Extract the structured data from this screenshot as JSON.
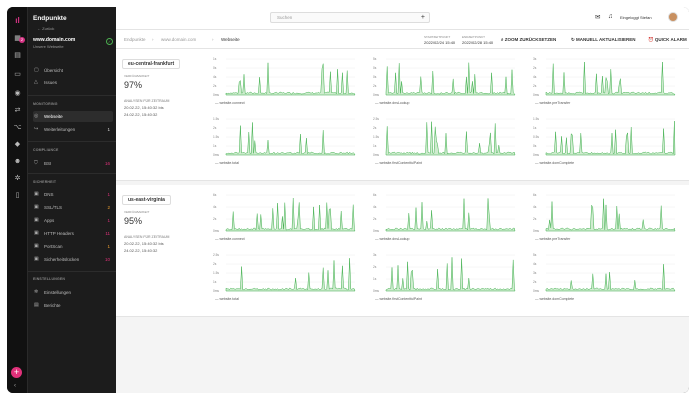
{
  "sidebar": {
    "title": "Endpunkte",
    "back": "Zurück",
    "domain": "www.domain.com",
    "domain_sub": "Unsere Webseite",
    "status_icon": "check-icon",
    "items_top": [
      {
        "label": "Übersicht",
        "icon": "dashboard-icon"
      },
      {
        "label": "Issues",
        "icon": "alert-icon"
      }
    ],
    "sections": {
      "monitoring": "MONITORING",
      "compliance": "COMPLIANCE",
      "security": "SICHERHEIT",
      "settings": "EINSTELLUNGEN"
    },
    "monitoring_items": [
      {
        "label": "Webseite",
        "icon": "globe-icon",
        "count": ""
      },
      {
        "label": "Weiterleitungen",
        "icon": "redirect-icon",
        "count": "1"
      }
    ],
    "compliance_items": [
      {
        "label": "BSI",
        "icon": "shield-icon",
        "count": "16"
      }
    ],
    "security_items": [
      {
        "label": "DNS",
        "icon": "dns-icon",
        "count": "1"
      },
      {
        "label": "SSL/TLS",
        "icon": "lock-icon",
        "count": "2"
      },
      {
        "label": "Apps",
        "icon": "apps-icon",
        "count": "1"
      },
      {
        "label": "HTTP Headers",
        "icon": "headers-icon",
        "count": "11"
      },
      {
        "label": "PortScan",
        "icon": "scan-icon",
        "count": "1"
      },
      {
        "label": "Sicherheitslücken",
        "icon": "bug-icon",
        "count": "10"
      }
    ],
    "settings_items": [
      {
        "label": "Einstellungen",
        "icon": "gear-icon"
      },
      {
        "label": "Berichte",
        "icon": "report-icon"
      }
    ]
  },
  "rail": {
    "badge": "2"
  },
  "topbar": {
    "search_placeholder": "Suchen",
    "user": "Eingeloggt Stefan"
  },
  "breadcrumb": {
    "items": [
      "Endpunkte",
      "www.domain.com",
      "Webseite"
    ],
    "start_label": "STARTZEITPUNKT",
    "start_value": "2022/02/24 15:40",
    "end_label": "ENDZEITPUNKT",
    "end_value": "2022/02/28 15:40",
    "actions": [
      "ZOOM ZURÜCKSETZEN",
      "MANUELL AKTUALISIEREN",
      "QUICK ALARM"
    ]
  },
  "locations": [
    {
      "name": "eu-central-frankfurt",
      "availability_label": "VERFÜGBARKEIT",
      "availability": "97%",
      "analysis_label": "ANALYSEN FÜR ZEITRAUM",
      "from": "20.02.22, 15:40:32 bis",
      "to": "24.02.22, 15:40:32",
      "charts": [
        {
          "legend": "website.connect",
          "yticks": [
            "1s",
            "0s",
            "4s",
            "2s",
            "0ms"
          ]
        },
        {
          "legend": "website.dnsLookup",
          "yticks": [
            "5s",
            "0s",
            "0s",
            "2s",
            "0ms"
          ]
        },
        {
          "legend": "website.preTransfer",
          "yticks": [
            "3s",
            "2s",
            "4s",
            "2s",
            "0ms"
          ]
        },
        {
          "legend": "website.total",
          "yticks": [
            "1.5s",
            "2s",
            "1.5s",
            "1s",
            "0ms"
          ]
        },
        {
          "legend": "website.firstContentfulPaint",
          "yticks": [
            "2.5s",
            "2s",
            "1.5s",
            "1s",
            "0ms"
          ]
        },
        {
          "legend": "website.domComplete",
          "yticks": [
            "1.5s",
            "1s",
            "0.5s",
            "0s",
            "0ms"
          ]
        }
      ]
    },
    {
      "name": "us-east-virginia",
      "availability_label": "VERFÜGBARKEIT",
      "availability": "95%",
      "analysis_label": "ANALYSEN FÜR ZEITRAUM",
      "from": "20.02.22, 15:40:32 bis",
      "to": "24.02.22, 15:40:32",
      "charts": [
        {
          "legend": "website.connect",
          "yticks": [
            "6s",
            "4s",
            "2s",
            "0ms"
          ]
        },
        {
          "legend": "website.dnsLookup",
          "yticks": [
            "6s",
            "4s",
            "2s",
            "0ms"
          ]
        },
        {
          "legend": "website.preTransfer",
          "yticks": [
            "6s",
            "4s",
            "2s",
            "0ms"
          ]
        },
        {
          "legend": "website.total",
          "yticks": [
            "2.5s",
            "2s",
            "1.5s",
            "1s",
            "0ms"
          ]
        },
        {
          "legend": "website.firstContentfulPaint",
          "yticks": [
            "3s",
            "2s",
            "1s",
            "0ms"
          ]
        },
        {
          "legend": "website.domComplete",
          "yticks": [
            "5s",
            "4s",
            "3s",
            "2s",
            "0ms"
          ]
        }
      ]
    }
  ],
  "colors": {
    "accent": "#e0317a",
    "line": "#3cae4a",
    "fill": "#cfeccf"
  }
}
